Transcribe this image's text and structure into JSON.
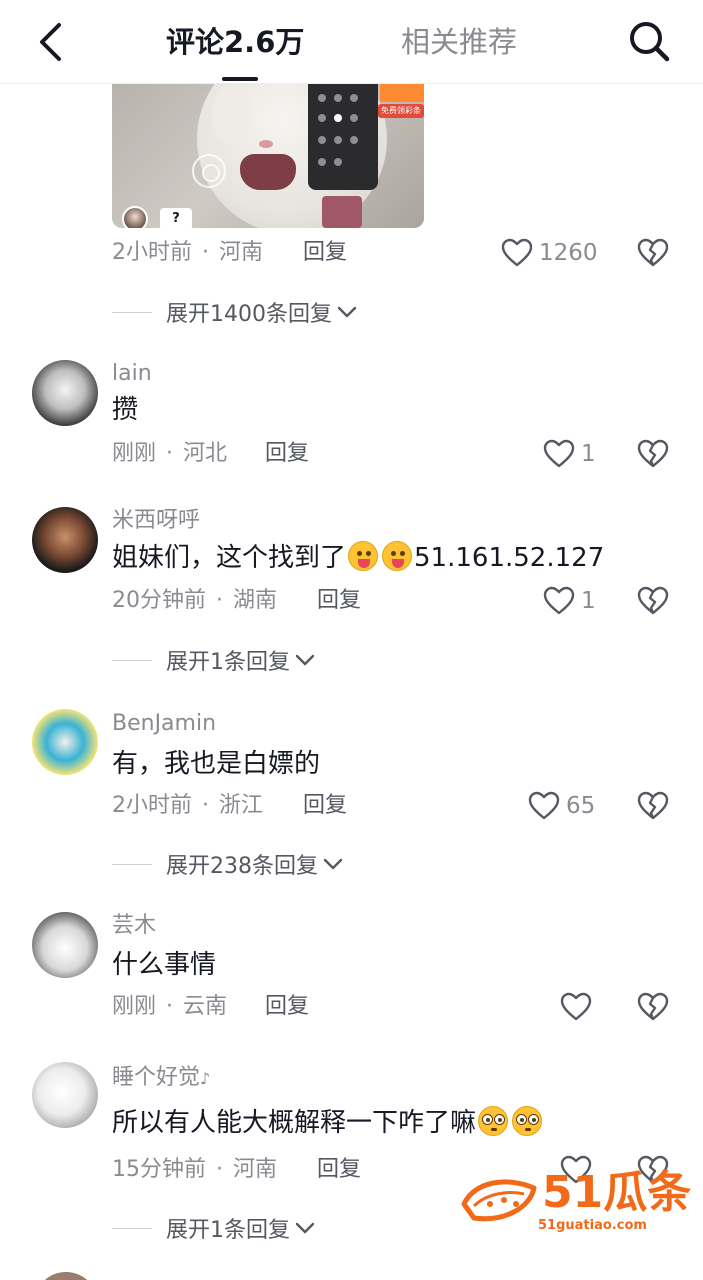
{
  "header": {
    "tab_comments": "评论2.6万",
    "tab_related": "相关推荐"
  },
  "thumbnail": {
    "promo_tag": "免费领彩条",
    "overlay_badge": "?"
  },
  "comments": [
    {
      "time": "2小时前",
      "separator": "·",
      "location": "河南",
      "reply_label": "回复",
      "likes": "1260",
      "expand_label": "展开1400条回复"
    },
    {
      "username": "lain",
      "text": "攒",
      "time": "刚刚",
      "separator": "·",
      "location": "河北",
      "reply_label": "回复",
      "likes": "1"
    },
    {
      "username": "米西呀呼",
      "text_before": "姐妹们，这个找到了",
      "text_after": "51.161.52.127",
      "emoji": "tongue-out-emoji",
      "time": "20分钟前",
      "separator": "·",
      "location": "湖南",
      "reply_label": "回复",
      "likes": "1",
      "expand_label": "展开1条回复"
    },
    {
      "username": "BenJamin",
      "text": "有，我也是白嫖的",
      "time": "2小时前",
      "separator": "·",
      "location": "浙江",
      "reply_label": "回复",
      "likes": "65",
      "expand_label": "展开238条回复"
    },
    {
      "username": "芸木",
      "text": "什么事情",
      "time": "刚刚",
      "separator": "·",
      "location": "云南",
      "reply_label": "回复",
      "likes": ""
    },
    {
      "username": "睡个好觉",
      "username_suffix": "♪",
      "text": "所以有人能大概解释一下咋了嘛",
      "emoji": "flushed-emoji",
      "time": "15分钟前",
      "separator": "·",
      "location": "河南",
      "reply_label": "回复",
      "likes": "",
      "expand_label": "展开1条回复"
    }
  ],
  "watermark": {
    "title": "51瓜条",
    "url": "51guatiao.com"
  },
  "colors": {
    "text_primary": "#161823",
    "text_secondary": "#8a8b91",
    "watermark": "#f26a18"
  },
  "icons": [
    "back-icon",
    "search-icon",
    "heart-icon",
    "broken-heart-icon",
    "chevron-down-icon"
  ]
}
